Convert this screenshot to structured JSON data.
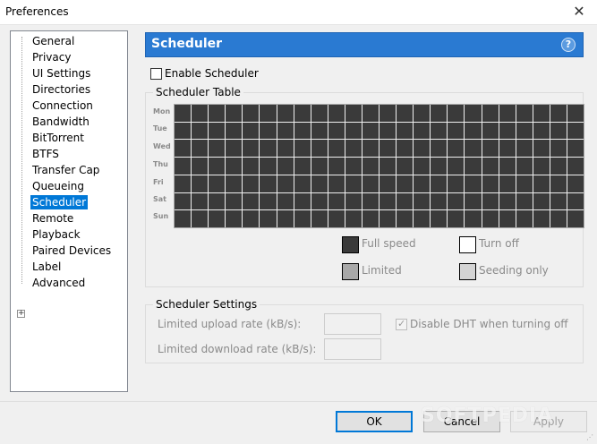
{
  "window": {
    "title": "Preferences",
    "close_glyph": "✕"
  },
  "tree": {
    "items": [
      {
        "label": "General"
      },
      {
        "label": "Privacy"
      },
      {
        "label": "UI Settings"
      },
      {
        "label": "Directories"
      },
      {
        "label": "Connection"
      },
      {
        "label": "Bandwidth"
      },
      {
        "label": "BitTorrent"
      },
      {
        "label": "BTFS"
      },
      {
        "label": "Transfer Cap"
      },
      {
        "label": "Queueing"
      },
      {
        "label": "Scheduler",
        "selected": true
      },
      {
        "label": "Remote"
      },
      {
        "label": "Playback"
      },
      {
        "label": "Paired Devices"
      },
      {
        "label": "Label"
      },
      {
        "label": "Advanced",
        "expander": "+"
      }
    ]
  },
  "header": {
    "title": "Scheduler",
    "help": "?"
  },
  "enable_scheduler": {
    "label": "Enable Scheduler",
    "checked": false
  },
  "table_group": {
    "title": "Scheduler Table"
  },
  "days": [
    "Mon",
    "Tue",
    "Wed",
    "Thu",
    "Fri",
    "Sat",
    "Sun"
  ],
  "hours_per_day": 24,
  "legend": {
    "full_speed": {
      "label": "Full speed",
      "color": "#3a3a3a"
    },
    "turn_off": {
      "label": "Turn off",
      "color": "#ffffff"
    },
    "limited": {
      "label": "Limited",
      "color": "#a8a8a8"
    },
    "seeding_only": {
      "label": "Seeding only",
      "color": "#d4d4d4"
    }
  },
  "settings_group": {
    "title": "Scheduler Settings",
    "upload_label": "Limited upload rate (kB/s):",
    "upload_value": "",
    "download_label": "Limited download rate (kB/s):",
    "download_value": "",
    "dht_label": "Disable DHT when turning off",
    "dht_checked": true
  },
  "buttons": {
    "ok": "OK",
    "cancel": "Cancel",
    "apply": "Apply"
  },
  "watermark": "SOFTPEDIA"
}
